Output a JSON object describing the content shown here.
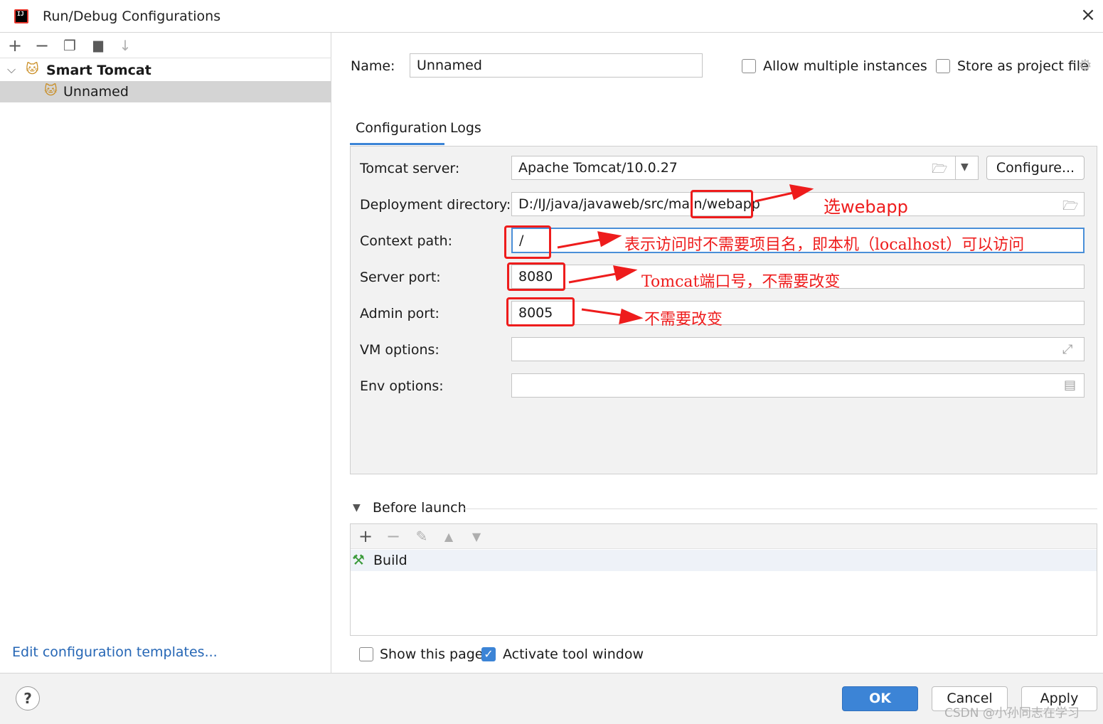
{
  "window": {
    "title": "Run/Debug Configurations",
    "app_icon_text": "IJ"
  },
  "left": {
    "toolbar": [
      "+",
      "−",
      "❐",
      "▆",
      "↓"
    ],
    "tree": {
      "group_label": "Smart Tomcat",
      "item_label": "Unnamed"
    },
    "edit_templates_link": "Edit configuration templates..."
  },
  "form": {
    "name_label": "Name:",
    "name_value": "Unnamed",
    "allow_multiple_label": "Allow multiple instances",
    "store_project_label": "Store as project file",
    "tabs": [
      "Configuration",
      "Logs"
    ],
    "tomcat_server_label": "Tomcat server:",
    "tomcat_server_value": "Apache Tomcat/10.0.27",
    "configure_button": "Configure...",
    "deployment_label": "Deployment directory:",
    "deployment_prefix": "D:/IJ/java/javaweb/src/main/",
    "deployment_highlight": "webapp",
    "context_label": "Context path:",
    "context_value": "/",
    "server_port_label": "Server port:",
    "server_port_value": "8080",
    "admin_port_label": "Admin port:",
    "admin_port_value": "8005",
    "vm_label": "VM options:",
    "vm_value": "",
    "env_label": "Env options:",
    "env_value": ""
  },
  "annotations": {
    "webapp": "选webapp",
    "context": "表示访问时不需要项目名，即本机（localhost）可以访问",
    "server_port": "Tomcat端口号，不需要改变",
    "admin_port": "不需要改变"
  },
  "before_launch": {
    "title": "Before launch",
    "toolbar": [
      "+",
      "−",
      "✎",
      "▲",
      "▼"
    ],
    "task_label": "Build"
  },
  "footer": {
    "show_page_label": "Show this page",
    "activate_tool_label": "Activate tool window",
    "help": "?",
    "ok": "OK",
    "cancel": "Cancel",
    "apply": "Apply",
    "watermark": "CSDN @小孙同志在学习"
  }
}
